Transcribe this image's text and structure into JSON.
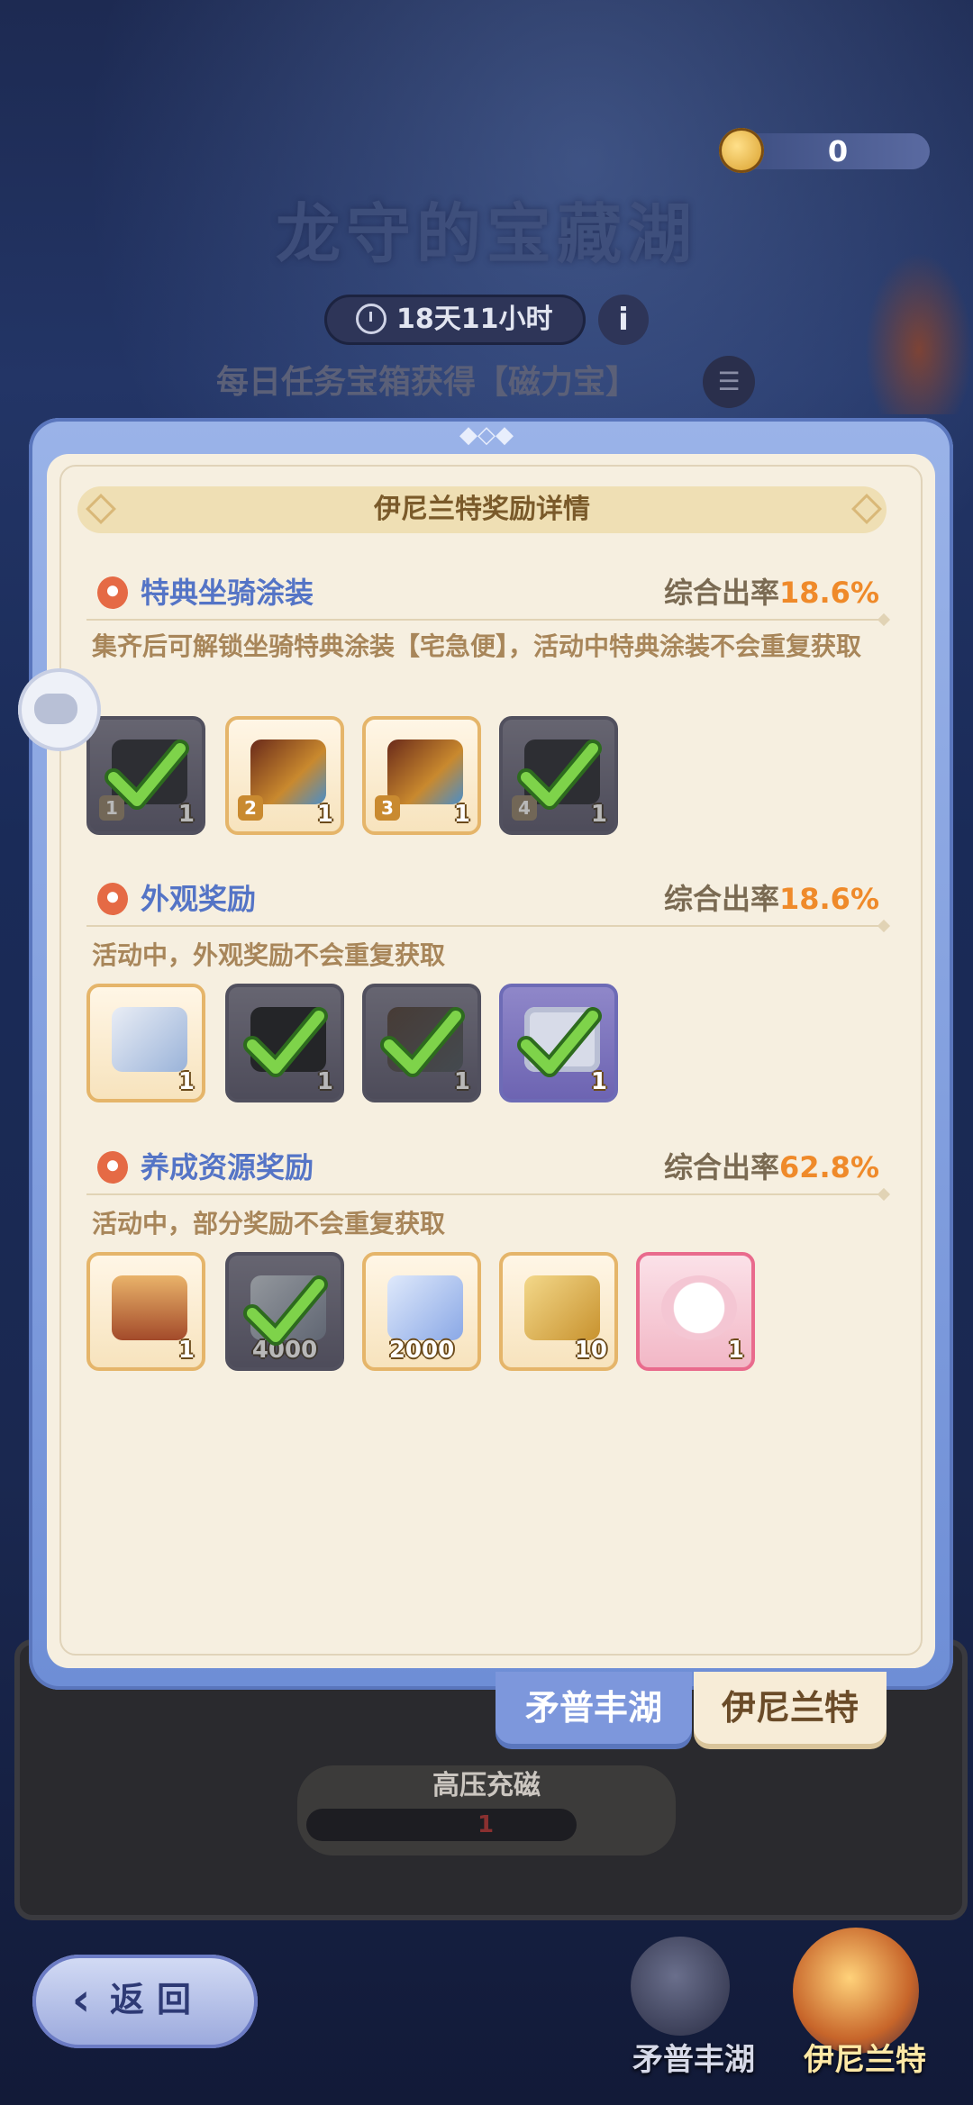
{
  "header": {
    "currency_value": "0",
    "event_title": "龙守的宝藏湖",
    "timer": "18天11小时",
    "info_symbol": "i",
    "daily_hint": "每日任务宝箱获得【磁力宝】"
  },
  "modal": {
    "title": "伊尼兰特奖励详情",
    "sections": [
      {
        "title": "特典坐骑涂装",
        "rate_label": "综合出率",
        "rate_value": "18.6%",
        "desc": "集齐后可解锁坐骑特典涂装【宅急便】，活动中特典涂装不会重复获取",
        "items": [
          {
            "icon": "mount-skin-part-icon",
            "index": "1",
            "qty": "1",
            "owned": true
          },
          {
            "icon": "mount-skin-part-icon",
            "index": "2",
            "qty": "1",
            "owned": false
          },
          {
            "icon": "mount-skin-part-icon",
            "index": "3",
            "qty": "1",
            "owned": false
          },
          {
            "icon": "mount-skin-part-icon",
            "index": "4",
            "qty": "1",
            "owned": true
          }
        ]
      },
      {
        "title": "外观奖励",
        "rate_label": "综合出率",
        "rate_value": "18.6%",
        "desc": "活动中，外观奖励不会重复获取",
        "items": [
          {
            "icon": "fish-ornament-icon",
            "qty": "1",
            "owned": false
          },
          {
            "icon": "cape-icon",
            "qty": "1",
            "owned": true
          },
          {
            "icon": "headgear-icon",
            "qty": "1",
            "owned": true
          },
          {
            "icon": "frame-icon",
            "qty": "1",
            "owned": true
          }
        ]
      },
      {
        "title": "养成资源奖励",
        "rate_label": "综合出率",
        "rate_value": "62.8%",
        "desc": "活动中，部分奖励不会重复获取",
        "items": [
          {
            "icon": "treasure-chest-icon",
            "qty": "1",
            "owned": false
          },
          {
            "icon": "blue-star-icon",
            "qty": "4000",
            "owned": true
          },
          {
            "icon": "blue-star-icon",
            "qty": "2000",
            "owned": false
          },
          {
            "icon": "lyre-icon",
            "qty": "10",
            "owned": false
          },
          {
            "icon": "cat-avatar-icon",
            "qty": "1",
            "owned": false
          }
        ]
      }
    ]
  },
  "tabs": [
    "矛普丰湖",
    "伊尼兰特"
  ],
  "underlying": {
    "charge_label": "高压充磁",
    "charge_value": "1"
  },
  "footer": {
    "back_label": "返回",
    "pool_left": "矛普丰湖",
    "pool_right": "伊尼兰特"
  },
  "colors": {
    "section_title": "#5474c6",
    "rate_highlight": "#ef8a2a",
    "modal_frame": "#7d97dc",
    "panel_bg": "#f6efe0"
  }
}
